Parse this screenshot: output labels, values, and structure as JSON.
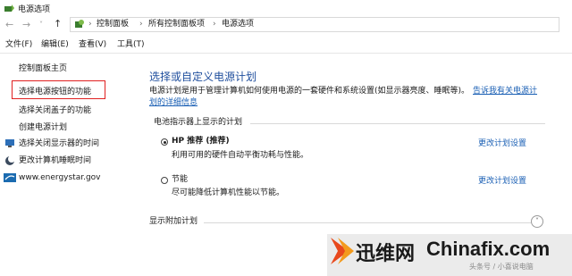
{
  "window": {
    "title": "电源选项"
  },
  "address": {
    "crumbs": [
      "控制面板",
      "所有控制面板项",
      "电源选项"
    ]
  },
  "menu": {
    "items": [
      "文件(F)",
      "编辑(E)",
      "查看(V)",
      "工具(T)"
    ]
  },
  "sidebar": {
    "home": "控制面板主页",
    "items": [
      {
        "label": "选择电源按钮的功能",
        "highlight": true
      },
      {
        "label": "选择关闭盖子的功能"
      },
      {
        "label": "创建电源计划"
      },
      {
        "label": "选择关闭显示器的时间"
      },
      {
        "label": "更改计算机睡眠时间"
      }
    ],
    "energystar": "www.energystar.gov"
  },
  "main": {
    "title": "选择或自定义电源计划",
    "desc1": "电源计划是用于管理计算机如何使用电源的一套硬件和系统设置(如显示器亮度、睡眠等)。",
    "desc_link1": "告诉我有关电源计",
    "desc_link2": "划的详细信息",
    "section_label": "电池指示器上显示的计划",
    "plans": [
      {
        "name": "HP 推荐 (推荐)",
        "desc": "利用可用的硬件自动平衡功耗与性能。",
        "selected": true,
        "change": "更改计划设置"
      },
      {
        "name": "节能",
        "desc": "尽可能降低计算机性能以节能。",
        "selected": false,
        "change": "更改计划设置"
      }
    ],
    "more_label": "显示附加计划"
  },
  "watermark": {
    "brand_cn": "迅维网",
    "brand_en": "Chinafix.com",
    "small": "头条号 / 小喜说电脑"
  },
  "colors": {
    "accent": "#1f4e9d",
    "link": "#1a5fb4",
    "highlight": "#e02020"
  }
}
